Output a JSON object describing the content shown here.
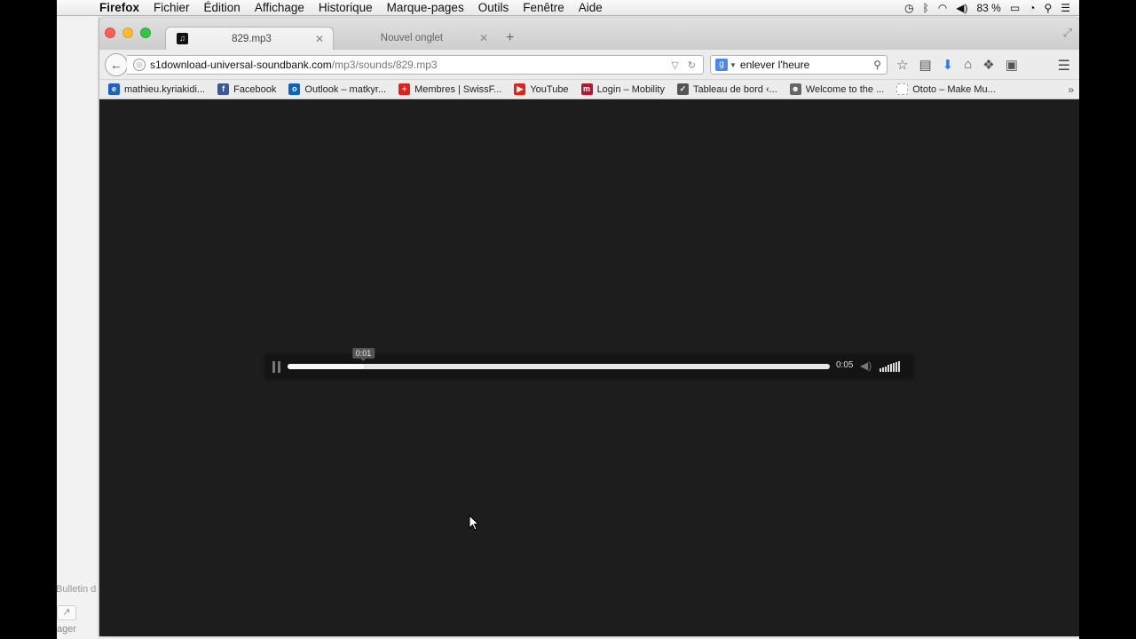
{
  "menubar": {
    "apple_icon": "apple-logo-icon",
    "items": [
      "Firefox",
      "Fichier",
      "Édition",
      "Affichage",
      "Historique",
      "Marque-pages",
      "Outils",
      "Fenêtre",
      "Aide"
    ],
    "battery": "83 %",
    "status_icons": [
      "time-machine-icon",
      "bluetooth-icon",
      "wifi-icon",
      "volume-icon",
      "battery-icon",
      "clock-icon",
      "spotlight-icon",
      "notification-center-icon"
    ]
  },
  "tabs": [
    {
      "title": "829.mp3",
      "active": true
    },
    {
      "title": "Nouvel onglet",
      "active": false
    }
  ],
  "navbar": {
    "url_host": "s1download-universal-soundbank.com",
    "url_path": "/mp3/sounds/829.mp3",
    "search_query": "enlever l'heure"
  },
  "bookmarks": [
    {
      "label": "mathieu.kyriakidi...",
      "icon": "e",
      "color": "#1f5fc8"
    },
    {
      "label": "Facebook",
      "icon": "f",
      "color": "#3b5998"
    },
    {
      "label": "Outlook – matkyr...",
      "icon": "o",
      "color": "#0a64c8"
    },
    {
      "label": "Membres | SwissF...",
      "icon": "+",
      "color": "#d9251d"
    },
    {
      "label": "YouTube",
      "icon": "▶",
      "color": "#e62117"
    },
    {
      "label": "Login – Mobility",
      "icon": "m",
      "color": "#b3182f"
    },
    {
      "label": "Tableau de bord ‹...",
      "icon": "✓",
      "color": "#555555"
    },
    {
      "label": "Welcome to the ...",
      "icon": "☻",
      "color": "#666666"
    },
    {
      "label": "Ototo – Make Mu...",
      "icon": "",
      "color": "#ffffff"
    }
  ],
  "player": {
    "hover_time": "0:01",
    "duration": "0:05",
    "progress_fraction": 0.14,
    "volume_bars": 8
  },
  "background_app": {
    "bulletin": "Bulletin d",
    "share_label": "ager"
  }
}
